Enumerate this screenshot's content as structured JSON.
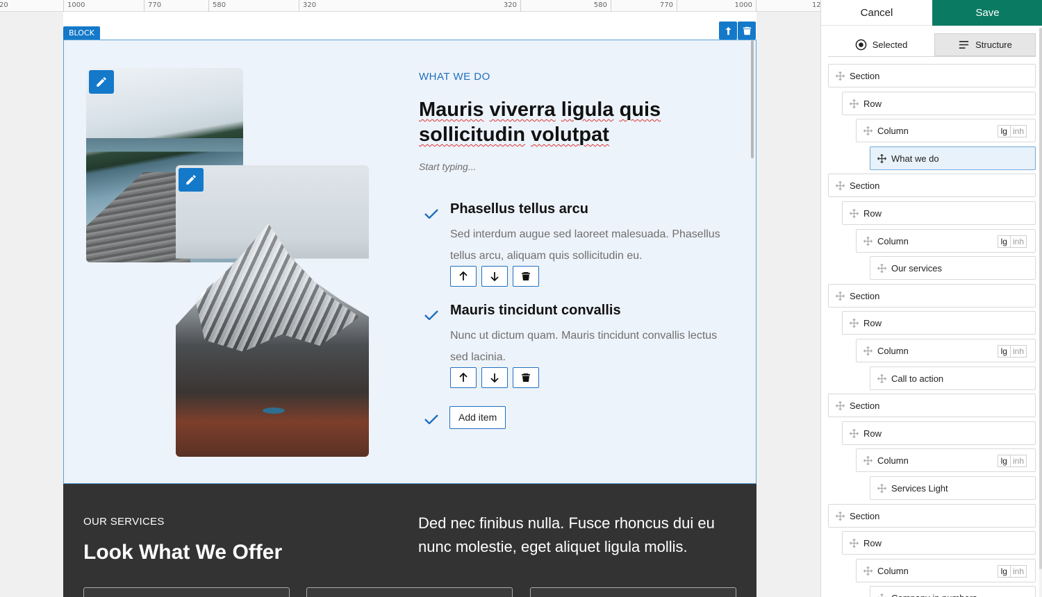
{
  "ruler": {
    "marks": [
      "20",
      "1000",
      "770",
      "580",
      "320",
      "320",
      "580",
      "770",
      "1000",
      "12"
    ]
  },
  "editor": {
    "block_label": "BLOCK",
    "icons": {
      "move_up": "arrow-up-icon",
      "delete": "trash-icon",
      "edit": "pencil-icon",
      "check": "checkmark-icon"
    },
    "accent_color": "#1479c9"
  },
  "what_we_do": {
    "eyebrow": "WHAT WE DO",
    "headline_words": [
      "Mauris",
      "viverra",
      "ligula",
      "quis",
      "sollicitudin",
      "volutpat"
    ],
    "placeholder": "Start typing...",
    "features": [
      {
        "title": "Phasellus tellus arcu",
        "text": "Sed interdum augue sed laoreet malesuada. Phasellus tellus arcu, aliquam quis sollicitudin eu."
      },
      {
        "title": "Mauris tincidunt convallis",
        "text": "Nunc ut dictum quam. Mauris tincidunt convallis lectus sed lacinia."
      }
    ],
    "add_item_label": "Add item"
  },
  "our_services": {
    "eyebrow": "OUR SERVICES",
    "title": "Look What We Offer",
    "text": "Ded nec finibus nulla. Fusce rhoncus dui eu nunc molestie, eget aliquet ligula mollis."
  },
  "panel": {
    "cancel_label": "Cancel",
    "save_label": "Save",
    "save_color": "#0b7a62",
    "tabs": {
      "selected": "Selected",
      "structure": "Structure"
    },
    "badge": {
      "size": "lg",
      "mode": "inh"
    },
    "tree": [
      {
        "label": "Section"
      },
      {
        "label": "Row"
      },
      {
        "label": "Column"
      },
      {
        "label": "What we do"
      },
      {
        "label": "Section"
      },
      {
        "label": "Row"
      },
      {
        "label": "Column"
      },
      {
        "label": "Our services"
      },
      {
        "label": "Section"
      },
      {
        "label": "Row"
      },
      {
        "label": "Column"
      },
      {
        "label": "Call to action"
      },
      {
        "label": "Section"
      },
      {
        "label": "Row"
      },
      {
        "label": "Column"
      },
      {
        "label": "Services Light"
      },
      {
        "label": "Section"
      },
      {
        "label": "Row"
      },
      {
        "label": "Column"
      },
      {
        "label": "Company in numbers"
      }
    ]
  }
}
